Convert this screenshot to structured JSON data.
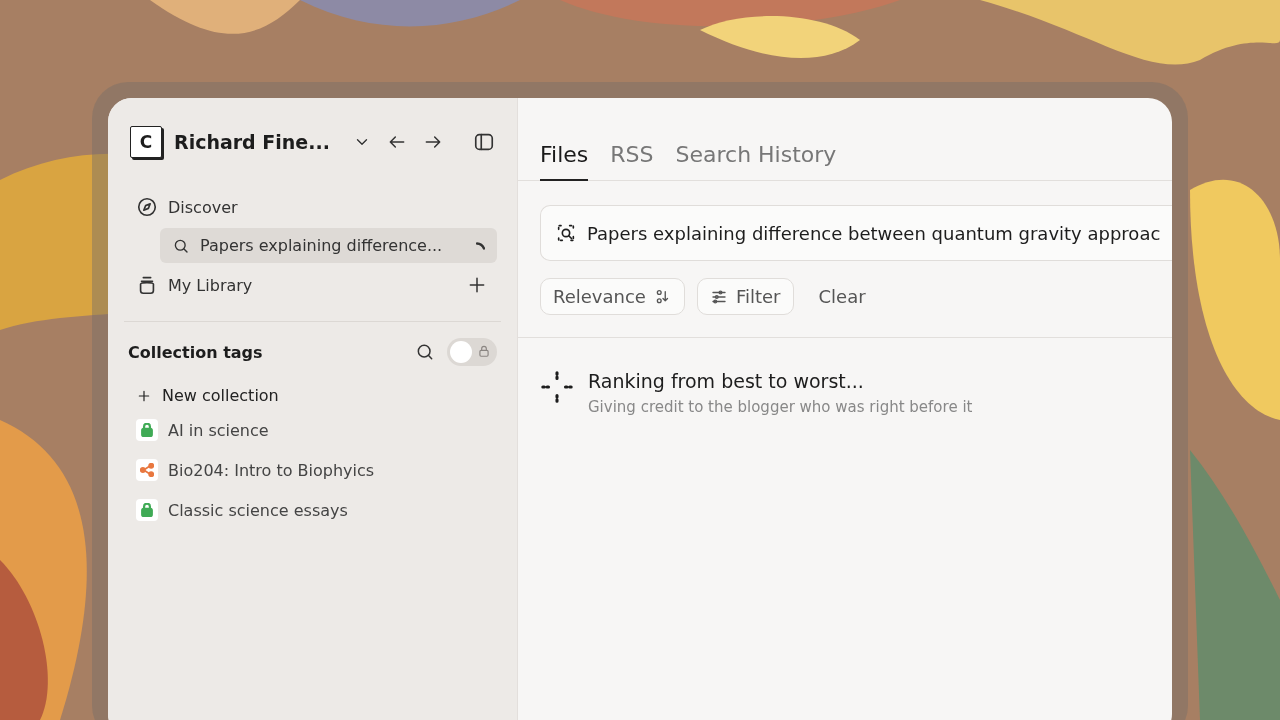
{
  "workspace": {
    "initial": "C",
    "name": "Richard Fine..."
  },
  "nav": [
    {
      "kind": "discover",
      "label": "Discover",
      "selected": false
    },
    {
      "kind": "search",
      "label": "Papers explaining difference...",
      "selected": true
    },
    {
      "kind": "library",
      "label": "My Library",
      "selected": false
    }
  ],
  "collections": {
    "title": "Collection tags",
    "private_only": false,
    "new_label": "New collection",
    "items": [
      {
        "kind": "private",
        "label": "AI in science",
        "color": "#3faa55"
      },
      {
        "kind": "shared",
        "label": "Bio204: Intro to Biophyics",
        "color": "#e8773f"
      },
      {
        "kind": "private",
        "label": "Classic science essays",
        "color": "#3faa55"
      }
    ]
  },
  "tabs": [
    {
      "label": "Files",
      "selected": true
    },
    {
      "label": "RSS",
      "selected": false
    },
    {
      "label": "Search History",
      "selected": false
    }
  ],
  "search": {
    "value": "Papers explaining difference between quantum gravity approac"
  },
  "sort": {
    "label": "Relevance"
  },
  "filter": {
    "label": "Filter"
  },
  "clear": {
    "label": "Clear"
  },
  "status": {
    "title": "Ranking from best to worst...",
    "subtitle": "Giving credit to the blogger who was right before it"
  }
}
